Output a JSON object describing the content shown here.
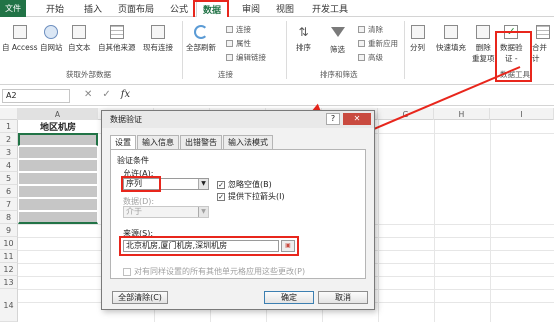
{
  "ribbon_tabs": [
    {
      "label": "文件"
    },
    {
      "label": "开始"
    },
    {
      "label": "插入"
    },
    {
      "label": "页面布局"
    },
    {
      "label": "公式"
    },
    {
      "label": "数据"
    },
    {
      "label": "审阅"
    },
    {
      "label": "视图"
    },
    {
      "label": "开发工具"
    }
  ],
  "ribbon": {
    "from_access": "自 Access",
    "from_web": "自网站",
    "from_text": "自文本",
    "from_other": "自其他来源",
    "existing_conn": "现有连接",
    "refresh_all": "全部刷新",
    "connections": "连接",
    "properties": "属性",
    "edit_links": "编辑链接",
    "sort": "排序",
    "filter": "筛选",
    "clear": "清除",
    "reapply": "重新应用",
    "advanced": "高级",
    "split": "分列",
    "flash_fill": "快速填充",
    "remove_dup": "删除",
    "remove_dup2": "重复项",
    "data_validation": "数据验",
    "data_validation2": "证 -",
    "consolidate": "合并计",
    "group_get_external": "获取外部数据",
    "group_connections": "连接",
    "group_sort_filter": "排序和筛选",
    "group_data_tools": "数据工具"
  },
  "formula_bar": {
    "name_box": "A2",
    "cancel_glyph": "✕",
    "enter_glyph": "✓",
    "fx": "fx",
    "formula": ""
  },
  "grid": {
    "columns": [
      "A",
      "B",
      "C",
      "D",
      "E",
      "F",
      "G",
      "H",
      "I"
    ],
    "rows": [
      "1",
      "2",
      "3",
      "4",
      "5",
      "6",
      "7",
      "8",
      "9",
      "10",
      "11",
      "12",
      "13",
      "14"
    ],
    "a1": "地区机房"
  },
  "dialog": {
    "title": "数据验证",
    "help": "?",
    "close": "✕",
    "tabs": [
      {
        "label": "设置"
      },
      {
        "label": "输入信息"
      },
      {
        "label": "出错警告"
      },
      {
        "label": "输入法模式"
      }
    ],
    "criteria_label": "验证条件",
    "allow_label": "允许(A):",
    "allow_value": "序列",
    "ignore_blank": "忽略空值(B)",
    "in_cell_dropdown": "提供下拉箭头(I)",
    "data_label": "数据(D):",
    "data_value": "介于",
    "source_label": "来源(S):",
    "source_value": "北京机房,厦门机房,深圳机房",
    "apply_all": "对有同样设置的所有其他单元格应用这些更改(P)",
    "clear_all": "全部清除(C)",
    "ok": "确定",
    "cancel": "取消"
  },
  "colors": {
    "excel_green": "#217346",
    "highlight_red": "#e8261c",
    "selection_grey": "#c6c6c6"
  }
}
